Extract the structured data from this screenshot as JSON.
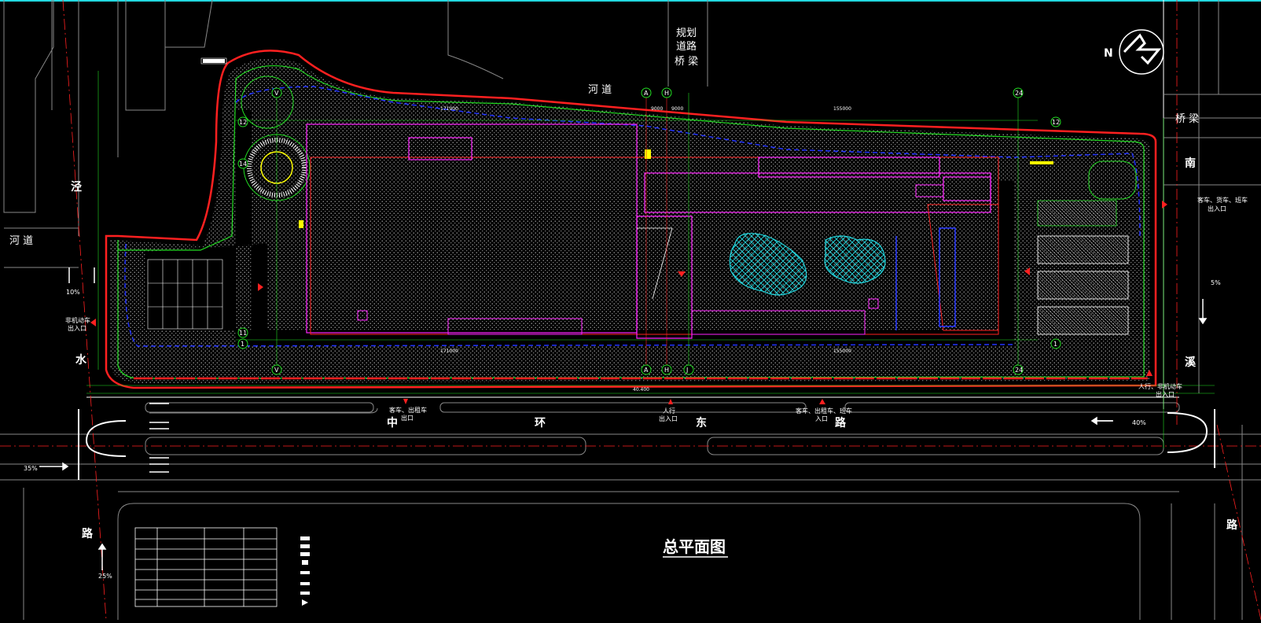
{
  "drawing": {
    "title": "总平面图",
    "north_symbol": "N"
  },
  "roads": {
    "main_road": [
      "中",
      "环",
      "东",
      "路"
    ],
    "west_road_top": "泾",
    "west_road_mid": "水",
    "west_road_bottom": "路",
    "east_road_top": "南",
    "east_road_mid": "溪",
    "east_road_bottom": "路",
    "river_north": "河  道",
    "river_west": "河  道",
    "planned_bridge": [
      "规划",
      "道路",
      "桥 梁"
    ],
    "bridge_east": "桥 梁"
  },
  "gates": {
    "gate_west": [
      "非机动车",
      "出入口"
    ],
    "gate_bottom_1": [
      "客车、出租车",
      "出口"
    ],
    "gate_bottom_2": [
      "人行",
      "出入口"
    ],
    "gate_bottom_3": [
      "客车、出租车、班车",
      "入口"
    ],
    "gate_east": [
      "客车、货车、班车",
      "出入口"
    ],
    "gate_se": [
      "人行、非机动车",
      "出入口"
    ]
  },
  "slopes": {
    "west": "10%",
    "east": "5%",
    "sw": "35%",
    "south": "25%",
    "se": "40%"
  },
  "axes": {
    "axis_a": "A",
    "axis_h": "H",
    "axis_j": "J",
    "axis_v": "V",
    "axis_24": "24",
    "axis_12": "12",
    "axis_1": "1",
    "axis_14": "14",
    "axis_11": "11"
  },
  "dimensions": {
    "d_171000_top": "171000",
    "d_155000_top": "155000",
    "d_171000_bottom": "171000",
    "d_155000_bottom": "155000",
    "d_9000_a": "9000",
    "d_9000_b": "9000",
    "d_total": "40.400"
  },
  "colors": {
    "red_line": "#ff2020",
    "green_line": "#22dd22",
    "magenta": "#ff22ff",
    "blue": "#2233ff",
    "cyan": "#22d8e0",
    "yellow": "#ffff00",
    "white": "#ffffff",
    "gray_line": "#888888"
  }
}
